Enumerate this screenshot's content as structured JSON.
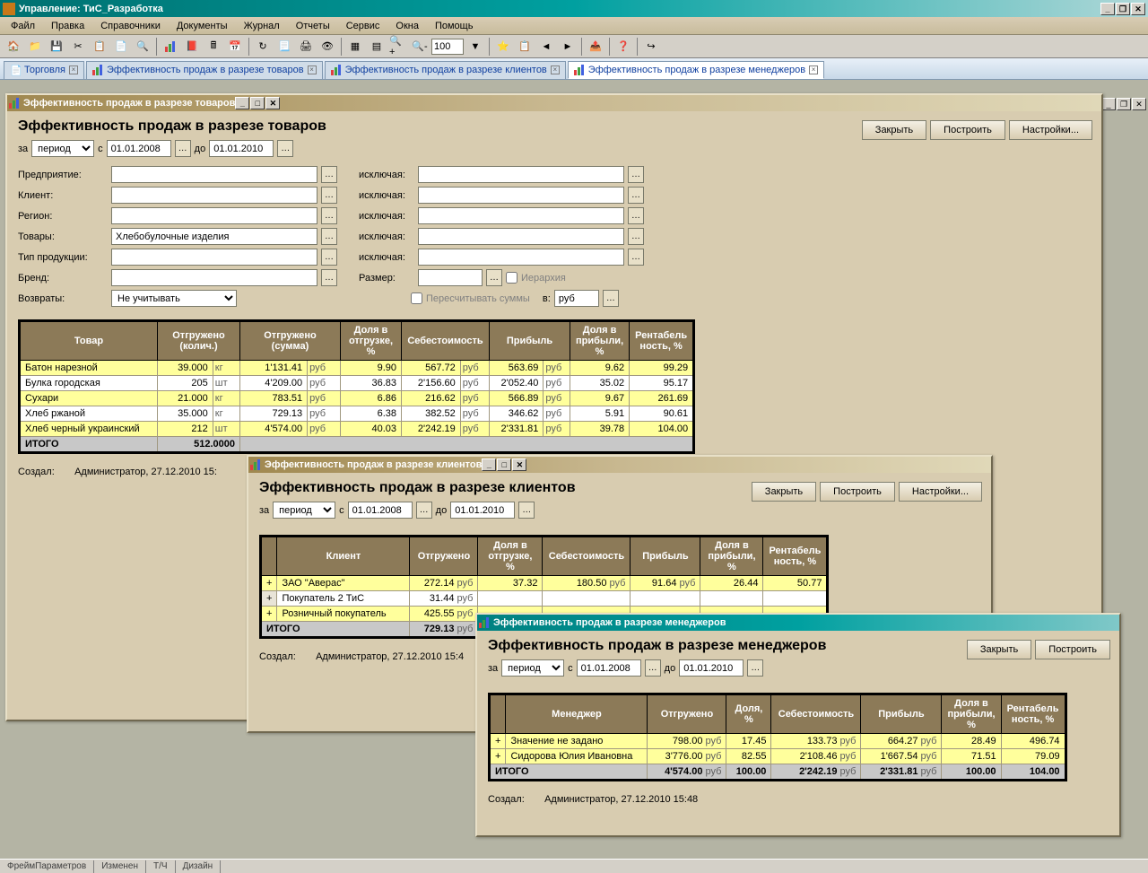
{
  "app": {
    "title": "Управление: ТиС_Разработка"
  },
  "menu": [
    "Файл",
    "Правка",
    "Справочники",
    "Документы",
    "Журнал",
    "Отчеты",
    "Сервис",
    "Окна",
    "Помощь"
  ],
  "toolbar": {
    "zoom": "100"
  },
  "tabs": [
    {
      "label": "Торговля"
    },
    {
      "label": "Эффективность продаж в разрезе товаров"
    },
    {
      "label": "Эффективность продаж в разрезе клиентов"
    },
    {
      "label": "Эффективность продаж в разрезе менеджеров"
    }
  ],
  "buttons": {
    "close": "Закрыть",
    "build": "Построить",
    "settings": "Настройки..."
  },
  "period": {
    "za": "за",
    "type": "период",
    "s": "с",
    "from": "01.01.2008",
    "do": "до",
    "to": "01.01.2010"
  },
  "labels": {
    "enterprise": "Предприятие:",
    "client": "Клиент:",
    "region": "Регион:",
    "goods": "Товары:",
    "prodtype": "Тип продукции:",
    "brand": "Бренд:",
    "returns": "Возвраты:",
    "excluding": "исключая:",
    "size": "Размер:",
    "hierarchy": "Иерархия",
    "recalc": "Пересчитывать суммы",
    "in": "в:",
    "created": "Создал:"
  },
  "values": {
    "goods": "Хлебобулочные изделия",
    "returns": "Не учитывать",
    "currency": "руб"
  },
  "win1": {
    "title": "Эффективность продаж в разрезе товаров",
    "heading": "Эффективность продаж в разрезе товаров",
    "created": "Администратор, 27.12.2010 15:",
    "headers": [
      "Товар",
      "Отгружено (колич.)",
      "Отгружено (сумма)",
      "Доля в отгрузке, %",
      "Себестоимость",
      "Прибыль",
      "Доля в прибыли, %",
      "Рентабель ность, %"
    ],
    "rows": [
      {
        "hl": true,
        "name": "Батон нарезной",
        "qty": "39.000",
        "qu": "кг",
        "sum": "1'131.41",
        "su": "руб",
        "share": "9.90",
        "cost": "567.72",
        "cu": "руб",
        "profit": "563.69",
        "pu": "руб",
        "pshare": "9.62",
        "rent": "99.29"
      },
      {
        "hl": false,
        "name": "Булка городская",
        "qty": "205",
        "qu": "шт",
        "sum": "4'209.00",
        "su": "руб",
        "share": "36.83",
        "cost": "2'156.60",
        "cu": "руб",
        "profit": "2'052.40",
        "pu": "руб",
        "pshare": "35.02",
        "rent": "95.17"
      },
      {
        "hl": true,
        "name": "Сухари",
        "qty": "21.000",
        "qu": "кг",
        "sum": "783.51",
        "su": "руб",
        "share": "6.86",
        "cost": "216.62",
        "cu": "руб",
        "profit": "566.89",
        "pu": "руб",
        "pshare": "9.67",
        "rent": "261.69"
      },
      {
        "hl": false,
        "name": "Хлеб ржаной",
        "qty": "35.000",
        "qu": "кг",
        "sum": "729.13",
        "su": "руб",
        "share": "6.38",
        "cost": "382.52",
        "cu": "руб",
        "profit": "346.62",
        "pu": "руб",
        "pshare": "5.91",
        "rent": "90.61"
      },
      {
        "hl": true,
        "name": "Хлеб черный украинский",
        "qty": "212",
        "qu": "шт",
        "sum": "4'574.00",
        "su": "руб",
        "share": "40.03",
        "cost": "2'242.19",
        "cu": "руб",
        "profit": "2'331.81",
        "pu": "руб",
        "pshare": "39.78",
        "rent": "104.00"
      }
    ],
    "total": {
      "label": "ИТОГО",
      "qty": "512.0000"
    }
  },
  "win2": {
    "title": "Эффективность продаж в разрезе клиентов",
    "heading": "Эффективность продаж в разрезе клиентов",
    "created": "Администратор, 27.12.2010 15:4",
    "headers": [
      "Клиент",
      "Отгружено",
      "Доля в отгрузке, %",
      "Себестоимость",
      "Прибыль",
      "Доля в прибыли, %",
      "Рентабель ность, %"
    ],
    "rows": [
      {
        "hl": true,
        "name": "ЗАО \"Аверас\"",
        "sum": "272.14",
        "su": "руб",
        "share": "37.32",
        "cost": "180.50",
        "cu": "руб",
        "profit": "91.64",
        "pu": "руб",
        "pshare": "26.44",
        "rent": "50.77"
      },
      {
        "hl": false,
        "name": "Покупатель 2 ТиС",
        "sum": "31.44",
        "su": "руб",
        "share": "",
        "cost": "",
        "cu": "",
        "profit": "",
        "pu": "",
        "pshare": "",
        "rent": ""
      },
      {
        "hl": true,
        "name": "Розничный покупатель",
        "sum": "425.55",
        "su": "руб",
        "share": "",
        "cost": "",
        "cu": "",
        "profit": "",
        "pu": "",
        "pshare": "",
        "rent": ""
      }
    ],
    "total": {
      "label": "ИТОГО",
      "sum": "729.13",
      "su": "руб"
    }
  },
  "win3": {
    "title": "Эффективность продаж в разрезе менеджеров",
    "heading": "Эффективность продаж в разрезе менеджеров",
    "created": "Администратор, 27.12.2010 15:48",
    "headers": [
      "Менеджер",
      "Отгружено",
      "Доля, %",
      "Себестоимость",
      "Прибыль",
      "Доля в прибыли, %",
      "Рентабель ность, %"
    ],
    "rows": [
      {
        "hl": true,
        "name": "Значение не задано",
        "sum": "798.00",
        "su": "руб",
        "share": "17.45",
        "cost": "133.73",
        "cu": "руб",
        "profit": "664.27",
        "pu": "руб",
        "pshare": "28.49",
        "rent": "496.74"
      },
      {
        "hl": true,
        "name": "Сидорова Юлия Ивановна",
        "sum": "3'776.00",
        "su": "руб",
        "share": "82.55",
        "cost": "2'108.46",
        "cu": "руб",
        "profit": "1'667.54",
        "pu": "руб",
        "pshare": "71.51",
        "rent": "79.09"
      }
    ],
    "total": {
      "label": "ИТОГО",
      "sum": "4'574.00",
      "su": "руб",
      "share": "100.00",
      "cost": "2'242.19",
      "cu": "руб",
      "profit": "2'331.81",
      "pu": "руб",
      "pshare": "100.00",
      "rent": "104.00"
    }
  },
  "status": [
    "ФреймПараметров",
    "Изменен",
    "Т/Ч",
    "Дизайн"
  ]
}
